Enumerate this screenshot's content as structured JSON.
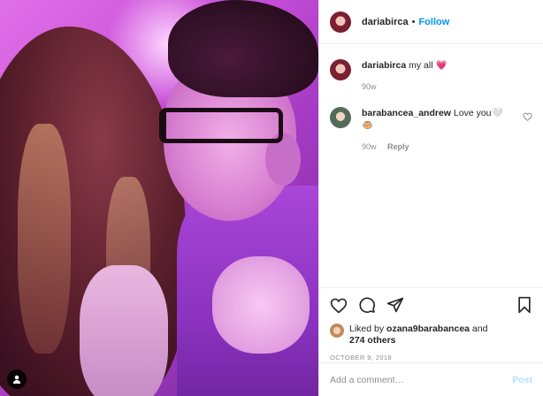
{
  "post": {
    "author": "dariabirca",
    "separator": "•",
    "follow_label": "Follow"
  },
  "comments": [
    {
      "username": "dariabirca",
      "text": "my all 💗",
      "age": "90w",
      "reply_label": ""
    },
    {
      "username": "barabancea_andrew",
      "text": "Love you🤍 🐵",
      "age": "90w",
      "reply_label": "Reply"
    }
  ],
  "likes": {
    "prefix": "Liked by",
    "liker": "ozana9barabancea",
    "and": "and",
    "others": "274 others"
  },
  "date": "OCTOBER 9, 2018",
  "add_comment": {
    "placeholder": "Add a comment…",
    "post_label": "Post"
  },
  "icons": {
    "like": "heart-icon",
    "comment": "comment-icon",
    "share": "share-icon",
    "save": "bookmark-icon",
    "tagged": "user-tag-icon"
  },
  "colors": {
    "link": "#0095f6",
    "post_disabled": "#b2dffc",
    "muted": "#8e8e8e"
  }
}
